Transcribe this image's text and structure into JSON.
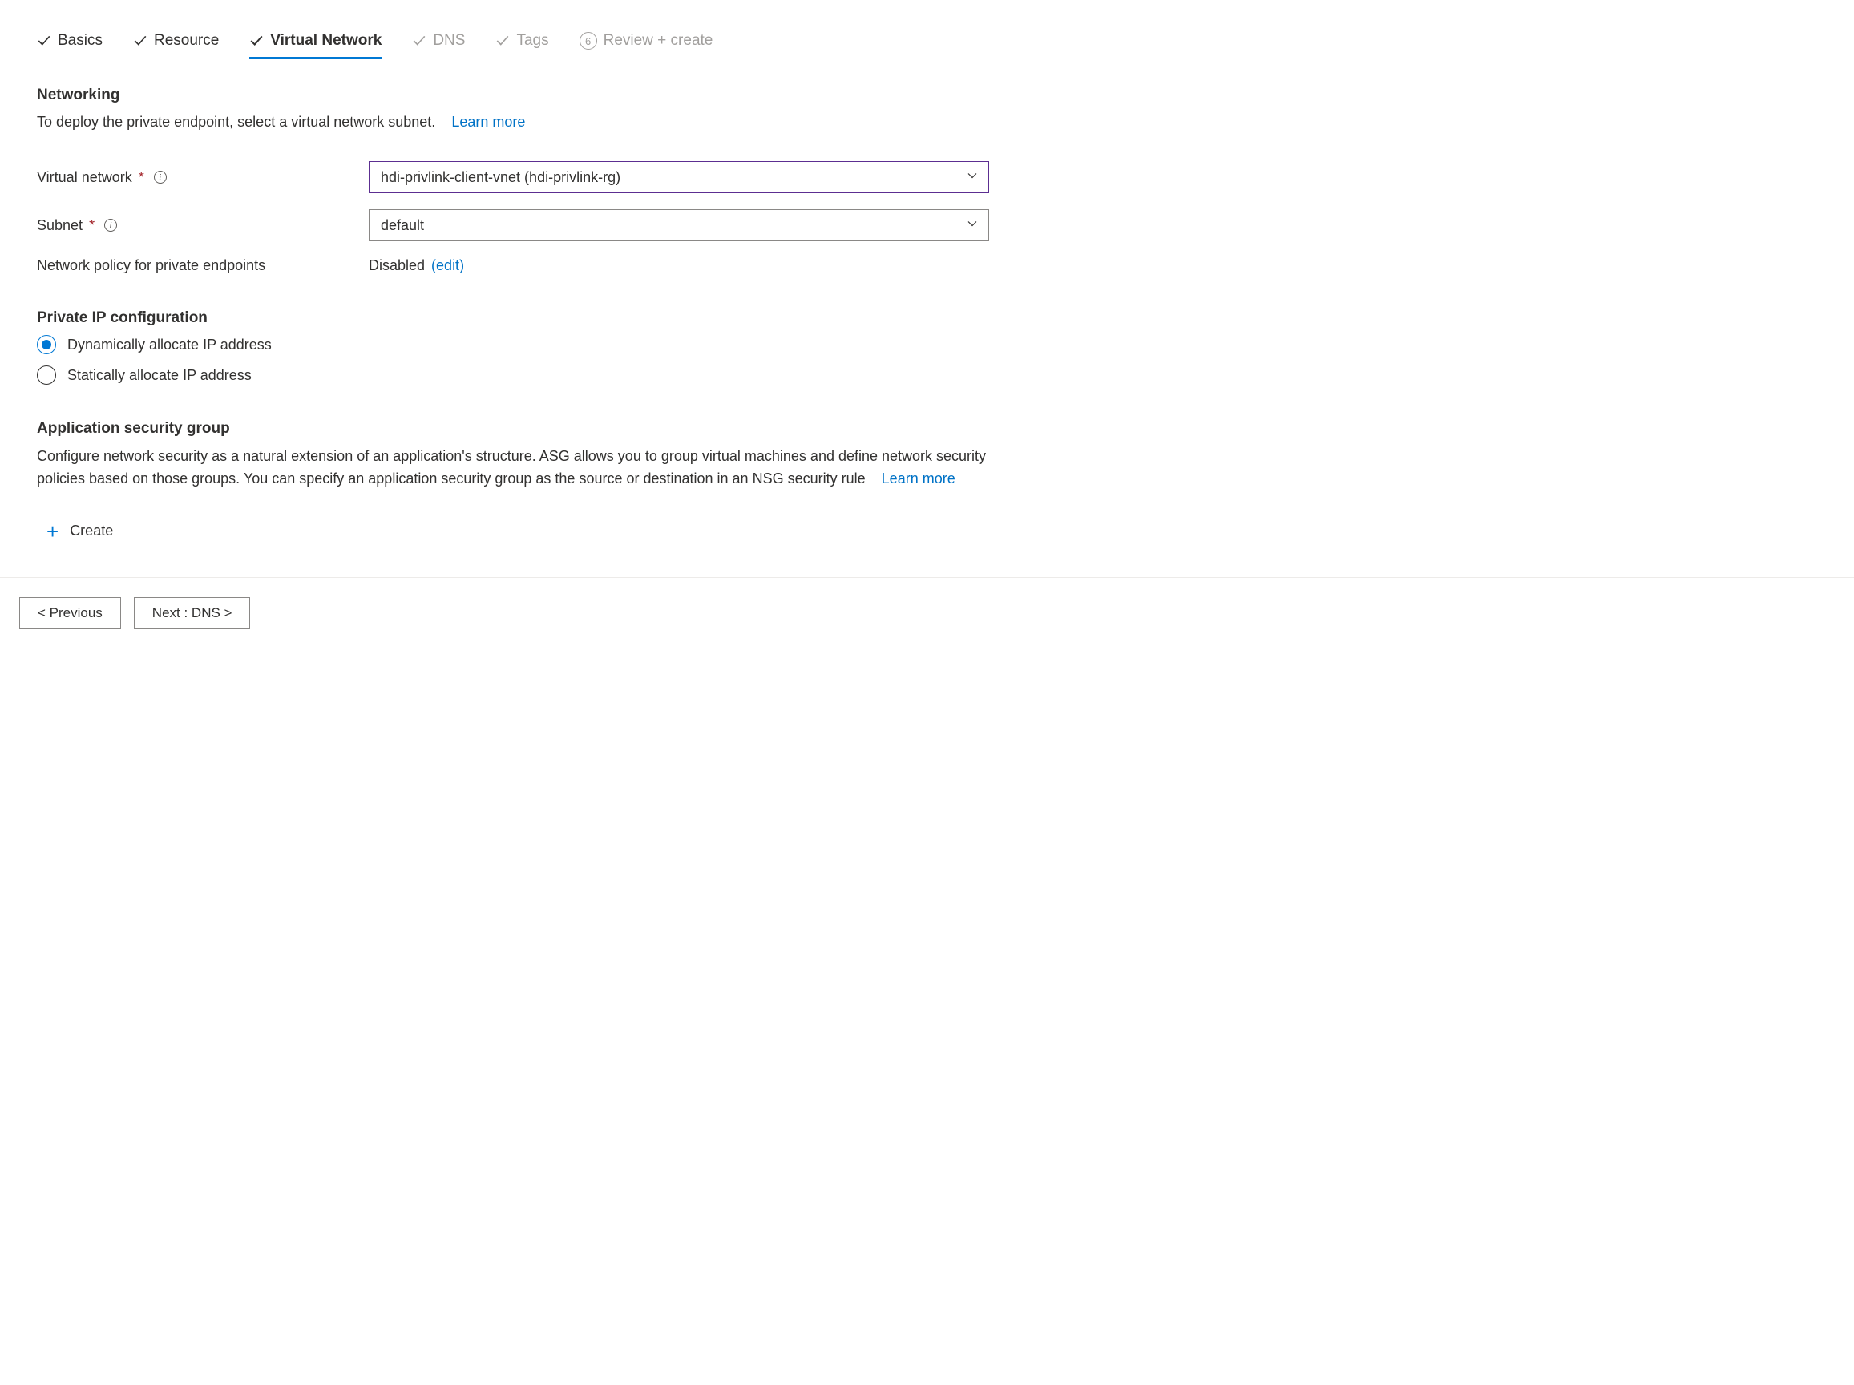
{
  "tabs": {
    "basics": "Basics",
    "resource": "Resource",
    "virtual_network": "Virtual Network",
    "dns": "DNS",
    "tags": "Tags",
    "review_step_number": "6",
    "review": "Review + create"
  },
  "networking": {
    "title": "Networking",
    "desc": "To deploy the private endpoint, select a virtual network subnet.",
    "learn_more": "Learn more",
    "virtual_network_label": "Virtual network",
    "virtual_network_value": "hdi-privlink-client-vnet (hdi-privlink-rg)",
    "subnet_label": "Subnet",
    "subnet_value": "default",
    "policy_label": "Network policy for private endpoints",
    "policy_value": "Disabled",
    "policy_edit": "(edit)"
  },
  "private_ip": {
    "title": "Private IP configuration",
    "option_dynamic": "Dynamically allocate IP address",
    "option_static": "Statically allocate IP address"
  },
  "asg": {
    "title": "Application security group",
    "desc": "Configure network security as a natural extension of an application's structure. ASG allows you to group virtual machines and define network security policies based on those groups. You can specify an application security group as the source or destination in an NSG security rule",
    "learn_more": "Learn more",
    "create": "Create"
  },
  "footer": {
    "previous": "< Previous",
    "next": "Next : DNS >"
  }
}
